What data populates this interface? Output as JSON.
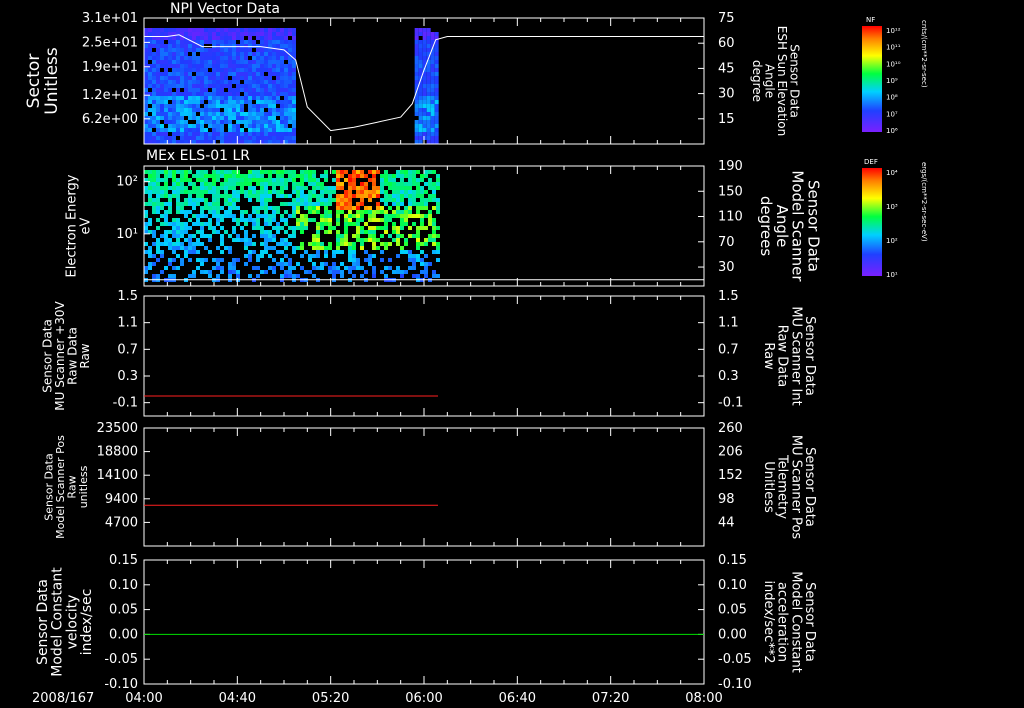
{
  "chart_data": [
    {
      "type": "heatmap",
      "title": "NPI Vector Data",
      "ylabel": [
        "Sector",
        "Unitless"
      ],
      "yticks": [
        "3.1e+01",
        "2.5e+01",
        "1.9e+01",
        "1.2e+01",
        "6.2e+00"
      ],
      "ylim": [
        0,
        31
      ],
      "overlay": {
        "ylabel": [
          "Sensor Data",
          "ESH Sun Elevation",
          "Angle",
          "degree"
        ],
        "yticks": [
          "75",
          "60",
          "45",
          "30",
          "15"
        ],
        "ylim": [
          0,
          75
        ],
        "x": [
          "04:00",
          "04:10",
          "04:15",
          "04:25",
          "04:40",
          "04:50",
          "05:00",
          "05:05",
          "05:10",
          "05:20",
          "05:30",
          "05:40",
          "05:50",
          "05:55",
          "06:00",
          "06:05",
          "06:10",
          "06:20",
          "08:00"
        ],
        "values": [
          64,
          64,
          65,
          58,
          58,
          58,
          56,
          50,
          22,
          8,
          10,
          13,
          16,
          24,
          44,
          62,
          64,
          64,
          64
        ]
      },
      "colorbar": {
        "label": "NF",
        "unit": "cnts/(cm**2-sr-sec)",
        "ticks": [
          "10¹²",
          "10¹¹",
          "10¹⁰",
          "10⁹",
          "10⁸",
          "10⁷",
          "10⁶"
        ]
      },
      "colors": {
        "overlay": "#ffffff"
      }
    },
    {
      "type": "heatmap",
      "title": "MEx ELS-01 LR",
      "ylabel": [
        "Electron Energy",
        "eV"
      ],
      "yticks": [
        "10²",
        "10¹"
      ],
      "ylog": true,
      "ylim": [
        1,
        200
      ],
      "overlay": {
        "ylabel": [
          "Sensor Data",
          "Model Scanner",
          "Angle",
          "degrees"
        ],
        "yticks": [
          "190",
          "150",
          "110",
          "70",
          "30"
        ],
        "ylim": [
          0,
          190
        ],
        "x": [
          "04:00",
          "06:06",
          "08:00"
        ],
        "values": [
          10,
          10,
          10
        ]
      },
      "colorbar": {
        "label": "DEF",
        "unit": "ergs/(cm**2-sr-sec-eV)",
        "ticks": [
          "10⁴",
          "10³",
          "10²",
          "10¹"
        ]
      },
      "colors": {
        "overlay": "#ffffff"
      }
    },
    {
      "type": "line",
      "ylabel": [
        "Sensor Data",
        "MU Scanner +30V",
        "Raw Data",
        "Raw"
      ],
      "yticks": [
        "1.5",
        "1.1",
        "0.7",
        "0.3",
        "-0.1"
      ],
      "ylim": [
        -0.3,
        1.5
      ],
      "right": {
        "ylabel": [
          "Sensor Data",
          "MU Scanner Int",
          "Raw Data",
          "Raw"
        ],
        "yticks": [
          "1.5",
          "1.1",
          "0.7",
          "0.3",
          "-0.1"
        ]
      },
      "series": [
        {
          "x": [
            "04:00",
            "06:06"
          ],
          "values": [
            0.0,
            0.0
          ]
        }
      ],
      "colors": {
        "line": "#ff2020",
        "right_label": "#ff2020"
      }
    },
    {
      "type": "line",
      "ylabel": [
        "Sensor Data",
        "Model Scanner Pos",
        "Raw",
        "unitless"
      ],
      "yticks": [
        "23500",
        "18800",
        "14100",
        "9400",
        "4700"
      ],
      "ylim": [
        0,
        23500
      ],
      "right": {
        "ylabel": [
          "Sensor Data",
          "MU Scanner Pos",
          "Telemetry",
          "Unitless"
        ],
        "yticks": [
          "260",
          "206",
          "152",
          "98",
          "44"
        ]
      },
      "series": [
        {
          "x": [
            "04:00",
            "06:06"
          ],
          "values": [
            8100,
            8100
          ]
        }
      ],
      "colors": {
        "line": "#ff2020",
        "right_label": "#ff2020"
      }
    },
    {
      "type": "line",
      "ylabel": [
        "Sensor Data",
        "Model Constant",
        "velocity",
        "index/sec"
      ],
      "yticks": [
        "0.15",
        "0.10",
        "0.05",
        "0.00",
        "-0.05",
        "-0.10"
      ],
      "ylim": [
        -0.1,
        0.15
      ],
      "right": {
        "ylabel": [
          "Sensor Data",
          "Model Constant",
          "acceleration",
          "index/sec**2"
        ],
        "yticks": [
          "0.15",
          "0.10",
          "0.05",
          "0.00",
          "-0.05",
          "-0.10"
        ]
      },
      "series": [
        {
          "x": [
            "04:00",
            "08:00"
          ],
          "values": [
            0.0,
            0.0
          ]
        }
      ],
      "colors": {
        "line": "#00e000",
        "right_label": "#00ff00"
      }
    }
  ],
  "x_axis": {
    "date": "2008/167",
    "range": [
      "04:00",
      "08:00"
    ],
    "ticks": [
      "04:00",
      "04:40",
      "05:20",
      "06:00",
      "06:40",
      "07:20",
      "08:00"
    ]
  }
}
